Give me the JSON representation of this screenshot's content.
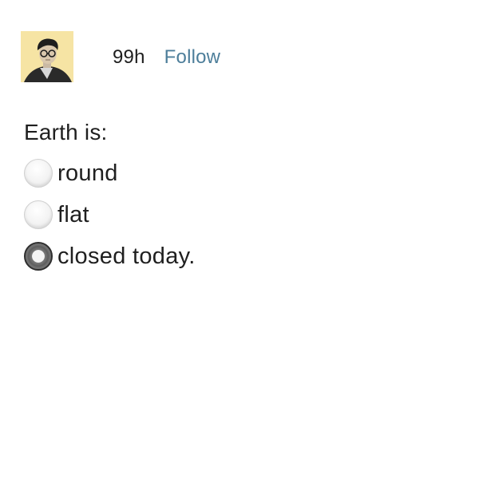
{
  "post": {
    "username": "99h",
    "follow_label": "Follow",
    "avatar_bg": "#f6e4a4"
  },
  "poll": {
    "question": "Earth is:",
    "options": [
      {
        "label": "round",
        "selected": false
      },
      {
        "label": "flat",
        "selected": false
      },
      {
        "label": "closed today.",
        "selected": true
      }
    ]
  },
  "colors": {
    "follow_link": "#4d7e9a",
    "text": "#1f1f1f"
  }
}
